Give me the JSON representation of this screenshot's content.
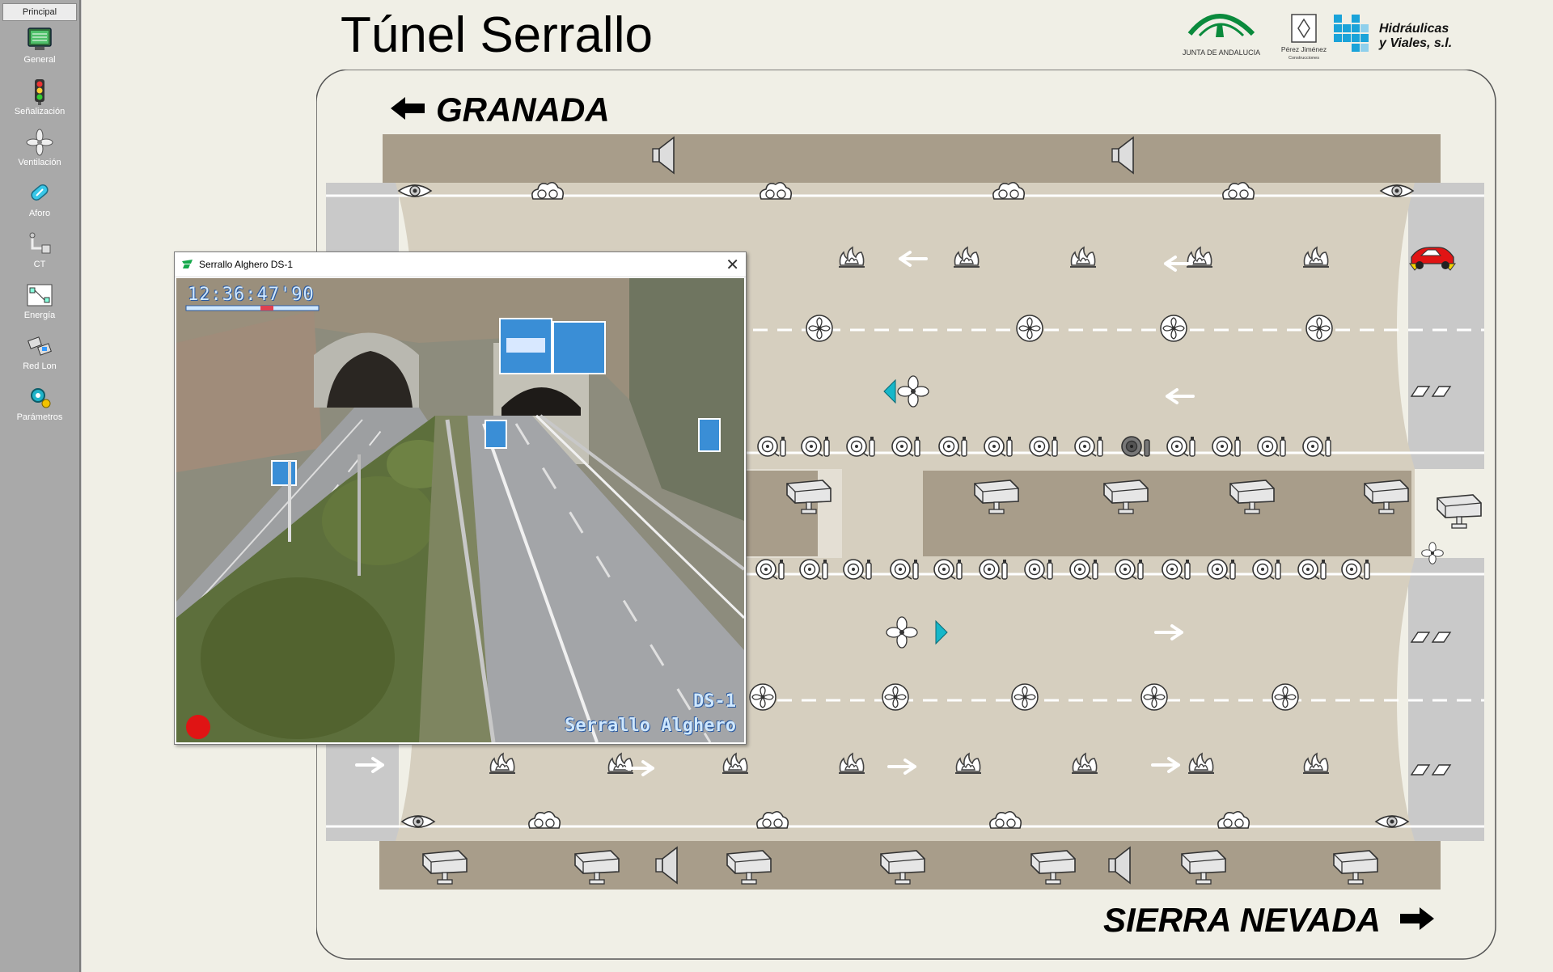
{
  "sidebar": {
    "header": "Principal",
    "items": [
      {
        "label": "General",
        "icon": "monitor-icon"
      },
      {
        "label": "Señalización",
        "icon": "traffic-light-icon"
      },
      {
        "label": "Ventilación",
        "icon": "fan-icon"
      },
      {
        "label": "Aforo",
        "icon": "counter-icon"
      },
      {
        "label": "CT",
        "icon": "transformer-icon"
      },
      {
        "label": "Energía",
        "icon": "energy-icon"
      },
      {
        "label": "Red Lon",
        "icon": "network-icon"
      },
      {
        "label": "Parámetros",
        "icon": "parameters-icon"
      }
    ]
  },
  "header": {
    "title": "Túnel Serrallo",
    "logos": {
      "junta": "JUNTA DE ANDALUCIA",
      "perez_line1": "Pérez Jiménez",
      "perez_line2": "Construcciones",
      "hidraulicas_line1": "Hidráulicas",
      "hidraulicas_line2": "y Viales, s.l."
    }
  },
  "tunnel": {
    "direction_top": "GRANADA",
    "direction_bottom": "SIERRA NEVADA",
    "colors": {
      "road": "#d6cfbf",
      "gallery": "#a89d8a",
      "portal": "#c9c9c9",
      "frame": "#f0efe6",
      "accent_cyan": "#16b7c9",
      "vehicle_red": "#e11414",
      "vehicle_yellow": "#f2d400"
    }
  },
  "camera_window": {
    "title": "Serrallo Alghero DS-1",
    "timestamp": "12:36:47'90",
    "label_line1": "DS-1",
    "label_line2": "Serrallo Alghero",
    "recording": true
  }
}
